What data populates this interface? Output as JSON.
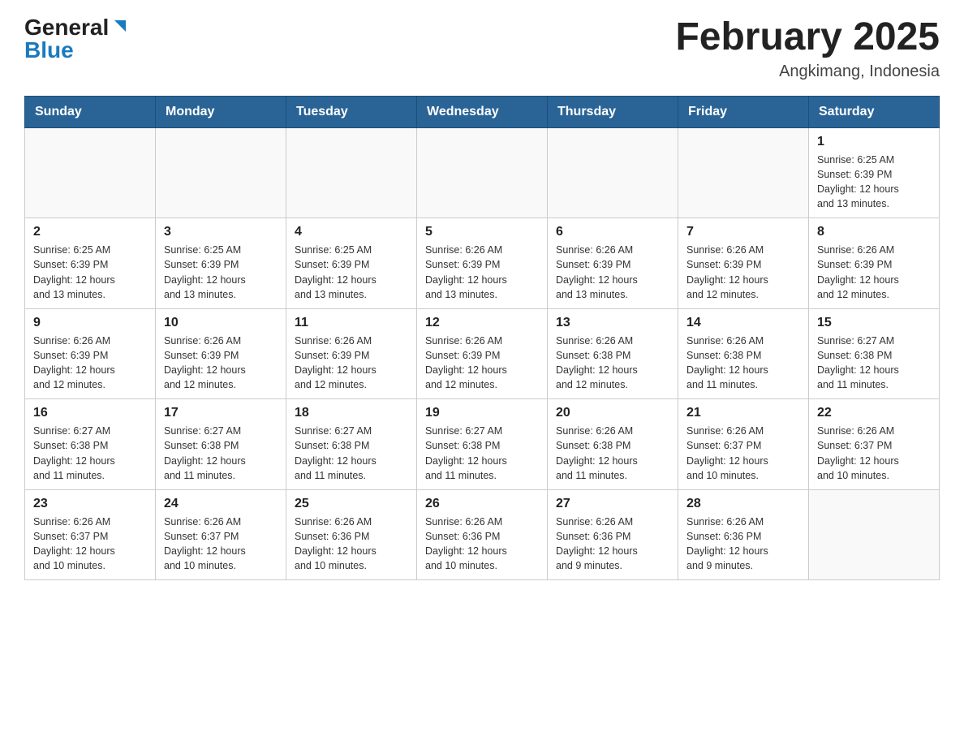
{
  "header": {
    "logo_general": "General",
    "logo_blue": "Blue",
    "title": "February 2025",
    "subtitle": "Angkimang, Indonesia"
  },
  "days_of_week": [
    "Sunday",
    "Monday",
    "Tuesday",
    "Wednesday",
    "Thursday",
    "Friday",
    "Saturday"
  ],
  "weeks": [
    {
      "days": [
        {
          "number": "",
          "info": ""
        },
        {
          "number": "",
          "info": ""
        },
        {
          "number": "",
          "info": ""
        },
        {
          "number": "",
          "info": ""
        },
        {
          "number": "",
          "info": ""
        },
        {
          "number": "",
          "info": ""
        },
        {
          "number": "1",
          "info": "Sunrise: 6:25 AM\nSunset: 6:39 PM\nDaylight: 12 hours\nand 13 minutes."
        }
      ]
    },
    {
      "days": [
        {
          "number": "2",
          "info": "Sunrise: 6:25 AM\nSunset: 6:39 PM\nDaylight: 12 hours\nand 13 minutes."
        },
        {
          "number": "3",
          "info": "Sunrise: 6:25 AM\nSunset: 6:39 PM\nDaylight: 12 hours\nand 13 minutes."
        },
        {
          "number": "4",
          "info": "Sunrise: 6:25 AM\nSunset: 6:39 PM\nDaylight: 12 hours\nand 13 minutes."
        },
        {
          "number": "5",
          "info": "Sunrise: 6:26 AM\nSunset: 6:39 PM\nDaylight: 12 hours\nand 13 minutes."
        },
        {
          "number": "6",
          "info": "Sunrise: 6:26 AM\nSunset: 6:39 PM\nDaylight: 12 hours\nand 13 minutes."
        },
        {
          "number": "7",
          "info": "Sunrise: 6:26 AM\nSunset: 6:39 PM\nDaylight: 12 hours\nand 12 minutes."
        },
        {
          "number": "8",
          "info": "Sunrise: 6:26 AM\nSunset: 6:39 PM\nDaylight: 12 hours\nand 12 minutes."
        }
      ]
    },
    {
      "days": [
        {
          "number": "9",
          "info": "Sunrise: 6:26 AM\nSunset: 6:39 PM\nDaylight: 12 hours\nand 12 minutes."
        },
        {
          "number": "10",
          "info": "Sunrise: 6:26 AM\nSunset: 6:39 PM\nDaylight: 12 hours\nand 12 minutes."
        },
        {
          "number": "11",
          "info": "Sunrise: 6:26 AM\nSunset: 6:39 PM\nDaylight: 12 hours\nand 12 minutes."
        },
        {
          "number": "12",
          "info": "Sunrise: 6:26 AM\nSunset: 6:39 PM\nDaylight: 12 hours\nand 12 minutes."
        },
        {
          "number": "13",
          "info": "Sunrise: 6:26 AM\nSunset: 6:38 PM\nDaylight: 12 hours\nand 12 minutes."
        },
        {
          "number": "14",
          "info": "Sunrise: 6:26 AM\nSunset: 6:38 PM\nDaylight: 12 hours\nand 11 minutes."
        },
        {
          "number": "15",
          "info": "Sunrise: 6:27 AM\nSunset: 6:38 PM\nDaylight: 12 hours\nand 11 minutes."
        }
      ]
    },
    {
      "days": [
        {
          "number": "16",
          "info": "Sunrise: 6:27 AM\nSunset: 6:38 PM\nDaylight: 12 hours\nand 11 minutes."
        },
        {
          "number": "17",
          "info": "Sunrise: 6:27 AM\nSunset: 6:38 PM\nDaylight: 12 hours\nand 11 minutes."
        },
        {
          "number": "18",
          "info": "Sunrise: 6:27 AM\nSunset: 6:38 PM\nDaylight: 12 hours\nand 11 minutes."
        },
        {
          "number": "19",
          "info": "Sunrise: 6:27 AM\nSunset: 6:38 PM\nDaylight: 12 hours\nand 11 minutes."
        },
        {
          "number": "20",
          "info": "Sunrise: 6:26 AM\nSunset: 6:38 PM\nDaylight: 12 hours\nand 11 minutes."
        },
        {
          "number": "21",
          "info": "Sunrise: 6:26 AM\nSunset: 6:37 PM\nDaylight: 12 hours\nand 10 minutes."
        },
        {
          "number": "22",
          "info": "Sunrise: 6:26 AM\nSunset: 6:37 PM\nDaylight: 12 hours\nand 10 minutes."
        }
      ]
    },
    {
      "days": [
        {
          "number": "23",
          "info": "Sunrise: 6:26 AM\nSunset: 6:37 PM\nDaylight: 12 hours\nand 10 minutes."
        },
        {
          "number": "24",
          "info": "Sunrise: 6:26 AM\nSunset: 6:37 PM\nDaylight: 12 hours\nand 10 minutes."
        },
        {
          "number": "25",
          "info": "Sunrise: 6:26 AM\nSunset: 6:36 PM\nDaylight: 12 hours\nand 10 minutes."
        },
        {
          "number": "26",
          "info": "Sunrise: 6:26 AM\nSunset: 6:36 PM\nDaylight: 12 hours\nand 10 minutes."
        },
        {
          "number": "27",
          "info": "Sunrise: 6:26 AM\nSunset: 6:36 PM\nDaylight: 12 hours\nand 9 minutes."
        },
        {
          "number": "28",
          "info": "Sunrise: 6:26 AM\nSunset: 6:36 PM\nDaylight: 12 hours\nand 9 minutes."
        },
        {
          "number": "",
          "info": ""
        }
      ]
    }
  ]
}
